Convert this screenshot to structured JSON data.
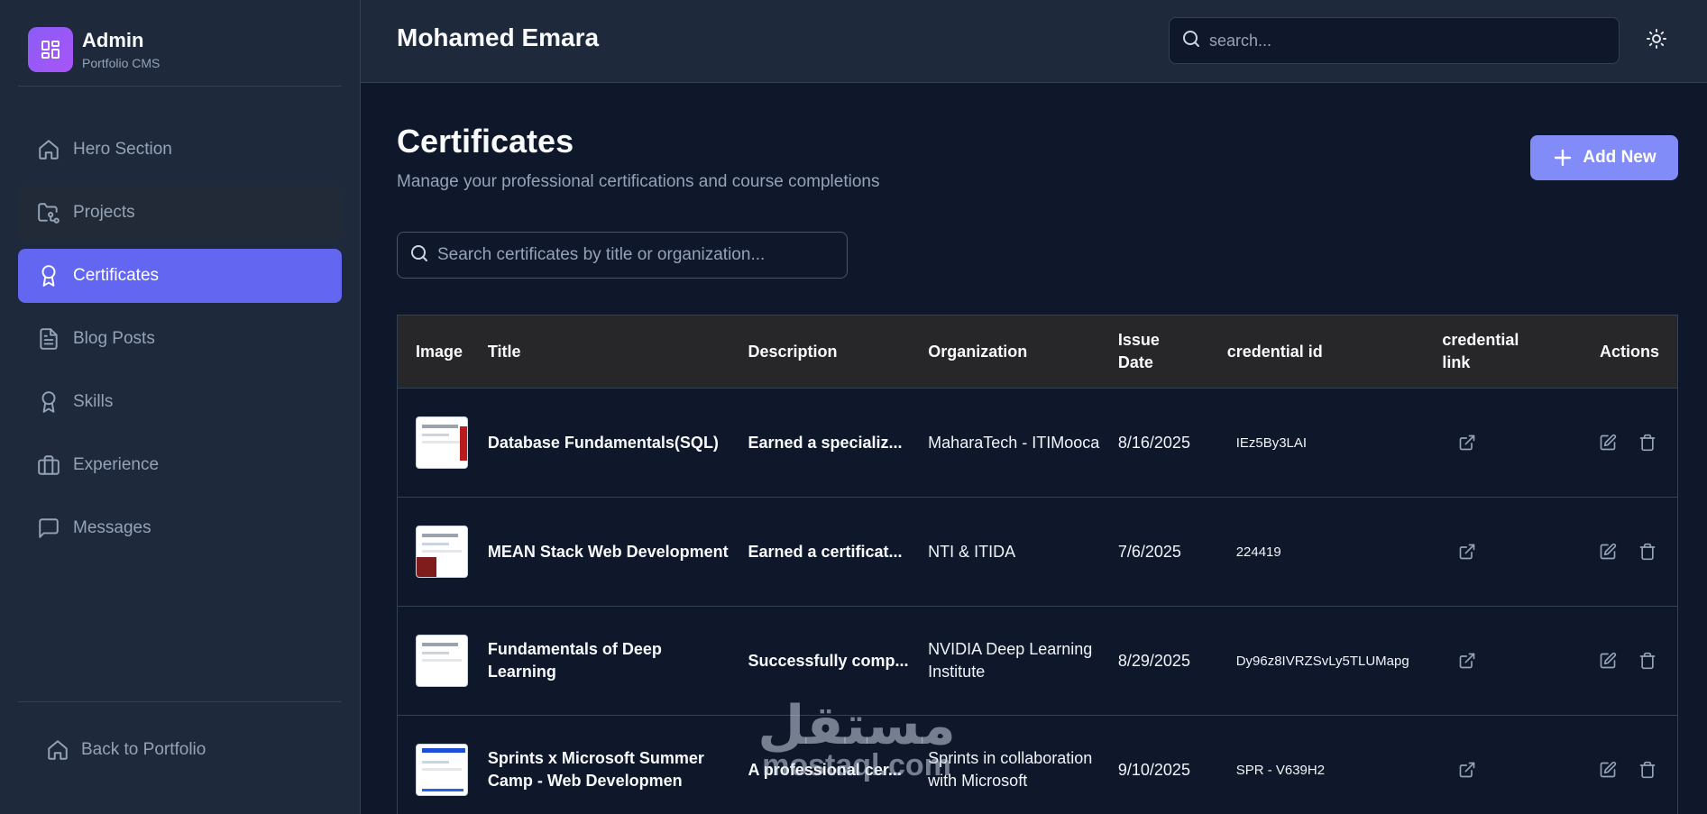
{
  "app": {
    "title": "Admin",
    "subtitle": "Portfolio CMS"
  },
  "sidebar": {
    "items": [
      {
        "label": "Hero Section",
        "icon": "home-icon",
        "state": "default"
      },
      {
        "label": "Projects",
        "icon": "folder-git-icon",
        "state": "hover"
      },
      {
        "label": "Certificates",
        "icon": "award-icon",
        "state": "active"
      },
      {
        "label": "Blog Posts",
        "icon": "file-text-icon",
        "state": "default"
      },
      {
        "label": "Skills",
        "icon": "award-icon",
        "state": "default"
      },
      {
        "label": "Experience",
        "icon": "briefcase-icon",
        "state": "default"
      },
      {
        "label": "Messages",
        "icon": "message-square-icon",
        "state": "default"
      }
    ],
    "back_label": "Back to Portfolio"
  },
  "header": {
    "user_name": "Mohamed Emara",
    "search_placeholder": "search..."
  },
  "page": {
    "title": "Certificates",
    "subtitle": "Manage your professional certifications and course completions",
    "add_label": "Add New",
    "search_placeholder": "Search certificates by title or organization..."
  },
  "table": {
    "headers": {
      "image": "Image",
      "title": "Title",
      "description": "Description",
      "organization": "Organization",
      "issue_date_1": "Issue",
      "issue_date_2": "Date",
      "credential_id": "credential id",
      "credential_link_1": "credential",
      "credential_link_2": "link",
      "actions": "Actions"
    },
    "rows": [
      {
        "title": "Database Fundamentals(SQL)",
        "description": "Earned a specializ...",
        "organization": "MaharaTech - ITIMooca",
        "issue_date": "8/16/2025",
        "credential_id": "IEz5By3LAI"
      },
      {
        "title": "MEAN Stack Web Development",
        "description": "Earned a certificat...",
        "organization": "NTI & ITIDA",
        "issue_date": "7/6/2025",
        "credential_id": "224419"
      },
      {
        "title": "Fundamentals of Deep Learning",
        "description": "Successfully comp...",
        "organization": "NVIDIA Deep Learning Institute",
        "issue_date": "8/29/2025",
        "credential_id": "Dy96z8IVRZSvLy5TLUMapg"
      },
      {
        "title": "Sprints x Microsoft Summer Camp - Web Developmen",
        "description": "A professional cer...",
        "organization": "Sprints in collaboration with Microsoft",
        "issue_date": "9/10/2025",
        "credential_id": "SPR - V639H2"
      }
    ]
  },
  "watermark": {
    "arabic": "مستقل",
    "latin": "mostaql.com"
  },
  "colors": {
    "accent": "#6366f1",
    "accent_light": "#818cf8",
    "background": "#0f172a",
    "surface": "#1e293b",
    "table_header": "#27272a"
  }
}
